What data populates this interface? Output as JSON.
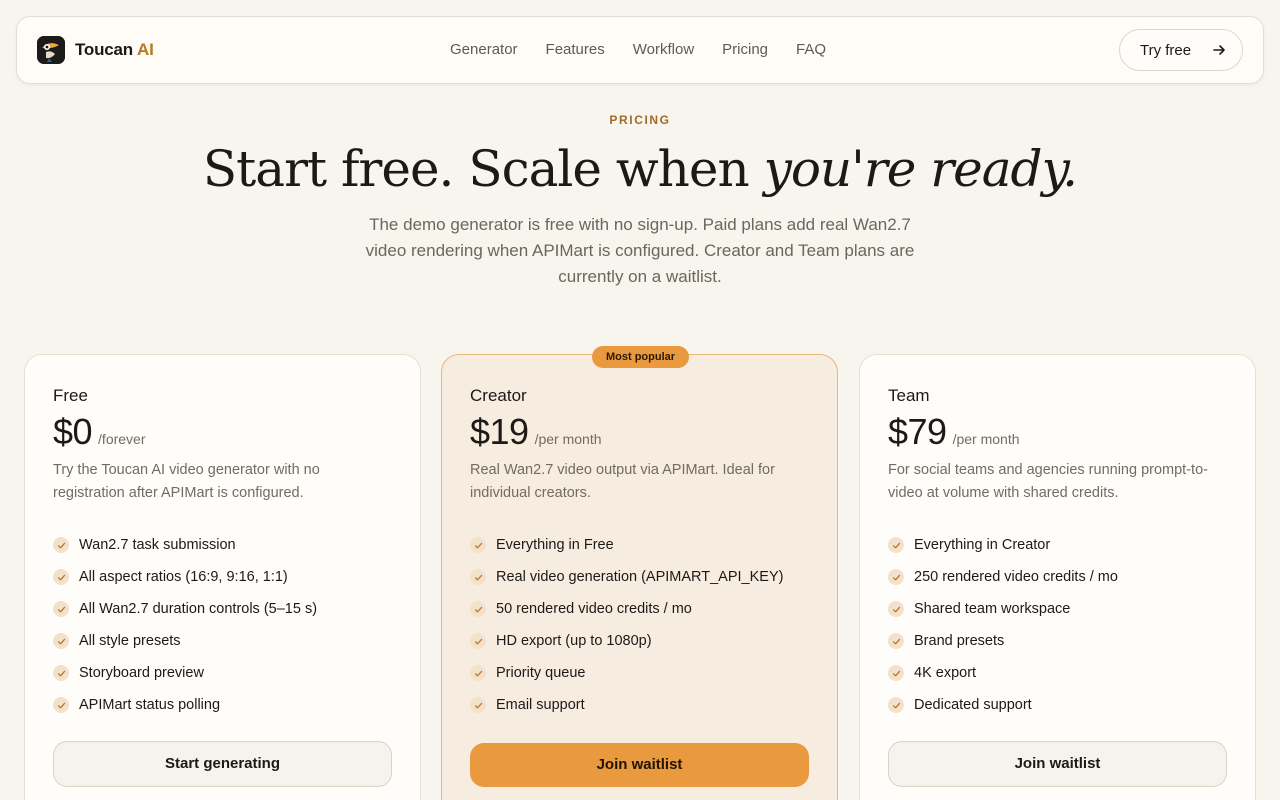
{
  "brand": {
    "name": "Toucan",
    "suffix": "AI"
  },
  "nav": {
    "links": [
      "Generator",
      "Features",
      "Workflow",
      "Pricing",
      "FAQ"
    ],
    "cta_label": "Try free"
  },
  "hero": {
    "eyebrow": "PRICING",
    "headline_plain": "Start free. Scale when ",
    "headline_italic": "you're ready.",
    "subtitle": "The demo generator is free with no sign-up. Paid plans add real Wan2.7 video rendering when APIMart is configured. Creator and Team plans are currently on a waitlist."
  },
  "plans": [
    {
      "name": "Free",
      "price": "$0",
      "period": "/forever",
      "description": "Try the Toucan AI video generator with no registration after APIMart is configured.",
      "features": [
        "Wan2.7 task submission",
        "All aspect ratios (16:9, 9:16, 1:1)",
        "All Wan2.7 duration controls (5–15 s)",
        "All style presets",
        "Storyboard preview",
        "APIMart status polling"
      ],
      "cta": "Start generating"
    },
    {
      "name": "Creator",
      "badge": "Most popular",
      "price": "$19",
      "period": "/per month",
      "description": "Real Wan2.7 video output via APIMart. Ideal for individual creators.",
      "features": [
        "Everything in Free",
        "Real video generation (APIMART_API_KEY)",
        "50 rendered video credits / mo",
        "HD export (up to 1080p)",
        "Priority queue",
        "Email support"
      ],
      "cta": "Join waitlist"
    },
    {
      "name": "Team",
      "price": "$79",
      "period": "/per month",
      "description": "For social teams and agencies running prompt-to-video at volume with shared credits.",
      "features": [
        "Everything in Creator",
        "250 rendered video credits / mo",
        "Shared team workspace",
        "Brand presets",
        "4K export",
        "Dedicated support"
      ],
      "cta": "Join waitlist"
    }
  ],
  "colors": {
    "accent": "#e9993e",
    "background": "#f8f4ee",
    "brand_ai": "#b9781f"
  }
}
